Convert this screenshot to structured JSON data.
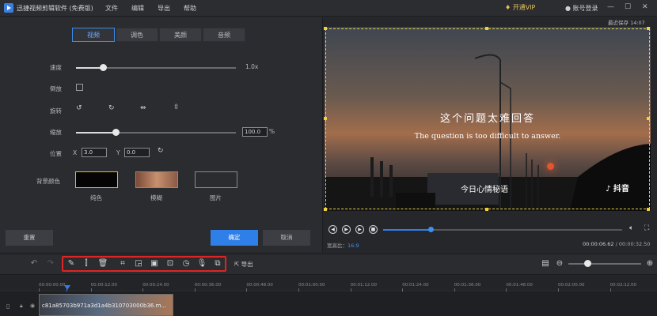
{
  "app": {
    "title": "迅捷视频剪辑软件 (免费版)",
    "menu": [
      "文件",
      "编辑",
      "导出",
      "帮助"
    ],
    "vip_label": "开通VIP",
    "login_label": "账号登录",
    "save_status": "最近保存 14:07"
  },
  "editor": {
    "tabs": [
      "视频",
      "调色",
      "美颜",
      "音频"
    ],
    "active_tab": "视频",
    "speed": {
      "label": "速度",
      "value": "1.0x",
      "level": 0.08
    },
    "reverse": {
      "label": "倒放",
      "checked": false
    },
    "rotate": {
      "label": "旋转"
    },
    "scale": {
      "label": "缩放",
      "value": "100.0",
      "unit": "%",
      "level": 0.25
    },
    "position": {
      "label": "位置",
      "x_label": "X",
      "x_value": "3.0",
      "y_label": "Y",
      "y_value": "0.0"
    },
    "background": {
      "label": "背景颜色",
      "options": [
        "纯色",
        "模糊",
        "图片"
      ]
    },
    "reset_label": "重置",
    "confirm_label": "确定",
    "cancel_label": "取消"
  },
  "preview": {
    "subtitle_cn": "这个问题太难回答",
    "subtitle_en": "The question is too difficult to answer.",
    "watermark_text": "今日心情秘语",
    "watermark_logo": "抖音",
    "current_time": "00:00:06.62",
    "total_time": "00:00:32.50",
    "time_separator": "/",
    "aspect_label": "宽高比：",
    "aspect_value": "16:9",
    "progress": 0.2
  },
  "toolbar": {
    "export_label": "导出",
    "tools": [
      "edit-icon",
      "split-icon",
      "delete-icon",
      "crop-icon",
      "speed-icon",
      "mosaic-icon",
      "freeze-icon",
      "duration-icon",
      "voice-icon",
      "dub-icon"
    ]
  },
  "timeline": {
    "ticks": [
      "00:00:00.00",
      "00:00:12.00",
      "00:00:24.00",
      "00:00:36.00",
      "00:00:48.00",
      "00:01:00.00",
      "00:01:12.00",
      "00:01:24.00",
      "00:01:36.00",
      "00:01:48.00",
      "00:02:00.00",
      "00:02:12.00"
    ],
    "clip_name": "c81a85703b971a3d1a4b310703000b36.m..."
  },
  "colors": {
    "accent": "#2f7fe8",
    "highlight_box": "#e02424"
  }
}
